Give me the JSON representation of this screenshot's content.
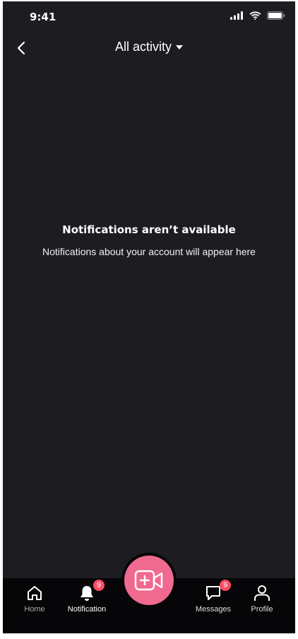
{
  "status_bar": {
    "time": "9:41"
  },
  "header": {
    "title": "All activity"
  },
  "empty_state": {
    "title": "Notifications aren’t available",
    "subtitle": "Notifications about your account will appear here"
  },
  "tab_bar": {
    "tabs": [
      {
        "label": "Home",
        "icon": "home-icon"
      },
      {
        "label": "Notification",
        "icon": "bell-icon",
        "badge": "9"
      },
      {
        "label": "Messages",
        "icon": "chat-icon",
        "badge": "9"
      },
      {
        "label": "Profile",
        "icon": "person-icon"
      }
    ],
    "fab_icon": "video-add-icon"
  },
  "colors": {
    "background": "#1c1c21",
    "tabbar": "#060608",
    "accent": "#f06a90",
    "badge": "#ff4a64"
  }
}
